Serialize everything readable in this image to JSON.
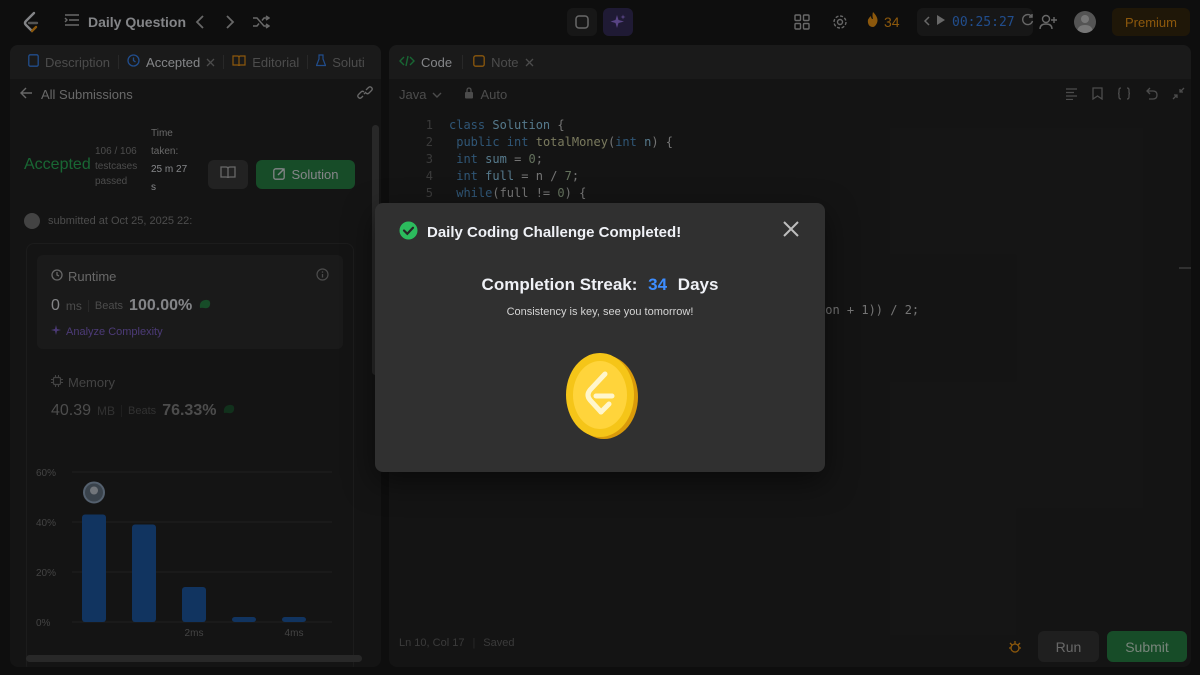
{
  "nav": {
    "title": "Daily Question",
    "streak_count": "34",
    "timer": "00:25:27",
    "premium_label": "Premium"
  },
  "left": {
    "tabs": [
      {
        "label": "Description"
      },
      {
        "label": "Accepted"
      },
      {
        "label": "Editorial"
      },
      {
        "label": "Soluti"
      }
    ],
    "back_label": "All Submissions",
    "status": "Accepted",
    "testcases_line1": "106 / 106",
    "testcases_line2": "testcases",
    "testcases_line3": "passed",
    "time_label_1": "Time",
    "time_label_2": "taken:",
    "time_value_1": "25 m 27",
    "time_value_2": "s",
    "solution_label": "Solution",
    "submitted_text": "submitted at Oct 25, 2025 22:",
    "runtime": {
      "heading": "Runtime",
      "value": "0",
      "unit": "ms",
      "beats_label": "Beats",
      "beats_value": "100.00%",
      "analyze_label": "Analyze Complexity"
    },
    "memory": {
      "heading": "Memory",
      "value": "40.39",
      "unit": "MB",
      "beats_label": "Beats",
      "beats_value": "76.33%"
    }
  },
  "chart_data": {
    "type": "bar",
    "categories": [
      "0ms",
      "1ms",
      "2ms",
      "3ms",
      "4ms"
    ],
    "x_tick_labels": [
      "",
      "",
      "2ms",
      "",
      "4ms"
    ],
    "values": [
      43,
      39,
      14,
      2,
      2
    ],
    "ylim": [
      0,
      60
    ],
    "y_ticks": [
      "0%",
      "20%",
      "40%",
      "60%"
    ],
    "grid": true,
    "highlight_category": "0ms",
    "bar_color": "#1f5fb0"
  },
  "right": {
    "tabs": [
      {
        "label": "Code"
      },
      {
        "label": "Note"
      }
    ],
    "language": "Java",
    "mode": "Auto",
    "code_tail": "mon + 1)) / 2;",
    "status_position": "Ln 10, Col 17",
    "status_saved": "Saved",
    "run_label": "Run",
    "submit_label": "Submit"
  },
  "modal": {
    "title": "Daily Coding Challenge Completed!",
    "streak_label": "Completion Streak:",
    "streak_value": "34",
    "streak_unit": "Days",
    "subtitle": "Consistency is key, see you tomorrow!"
  },
  "colors": {
    "accent_green": "#2cbb5d",
    "accent_blue": "#3d8dff",
    "accent_orange": "#ffa116",
    "coin_gold": "#f5c518"
  }
}
